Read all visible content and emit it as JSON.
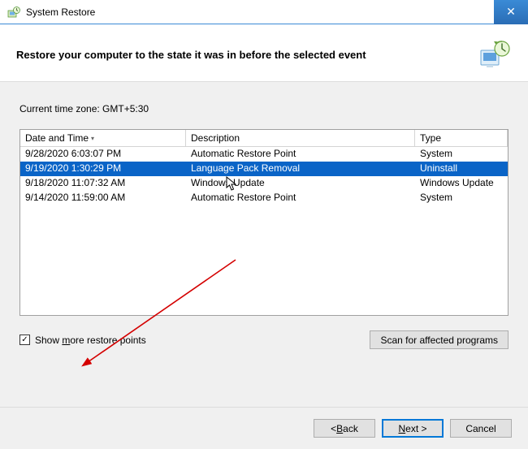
{
  "titlebar": {
    "title": "System Restore",
    "close_glyph": "✕"
  },
  "header": {
    "subtitle": "Restore your computer to the state it was in before the selected event"
  },
  "timezone_label": "Current time zone: GMT+5:30",
  "columns": {
    "date": "Date and Time",
    "desc": "Description",
    "type": "Type"
  },
  "rows": [
    {
      "date": "9/28/2020 6:03:07 PM",
      "desc": "Automatic Restore Point",
      "type": "System",
      "selected": false
    },
    {
      "date": "9/19/2020 1:30:29 PM",
      "desc": "Language Pack Removal",
      "type": "Uninstall",
      "selected": true
    },
    {
      "date": "9/18/2020 11:07:32 AM",
      "desc": "Windows Update",
      "type": "Windows Update",
      "selected": false
    },
    {
      "date": "9/14/2020 11:59:00 AM",
      "desc": "Automatic Restore Point",
      "type": "System",
      "selected": false
    }
  ],
  "checkbox": {
    "label_pre": "Show ",
    "label_key": "m",
    "label_post": "ore restore points",
    "checked_glyph": "✓"
  },
  "buttons": {
    "scan": "Scan for affected programs",
    "back_pre": "< ",
    "back_key": "B",
    "back_post": "ack",
    "next_key": "N",
    "next_post": "ext >",
    "cancel": "Cancel"
  }
}
